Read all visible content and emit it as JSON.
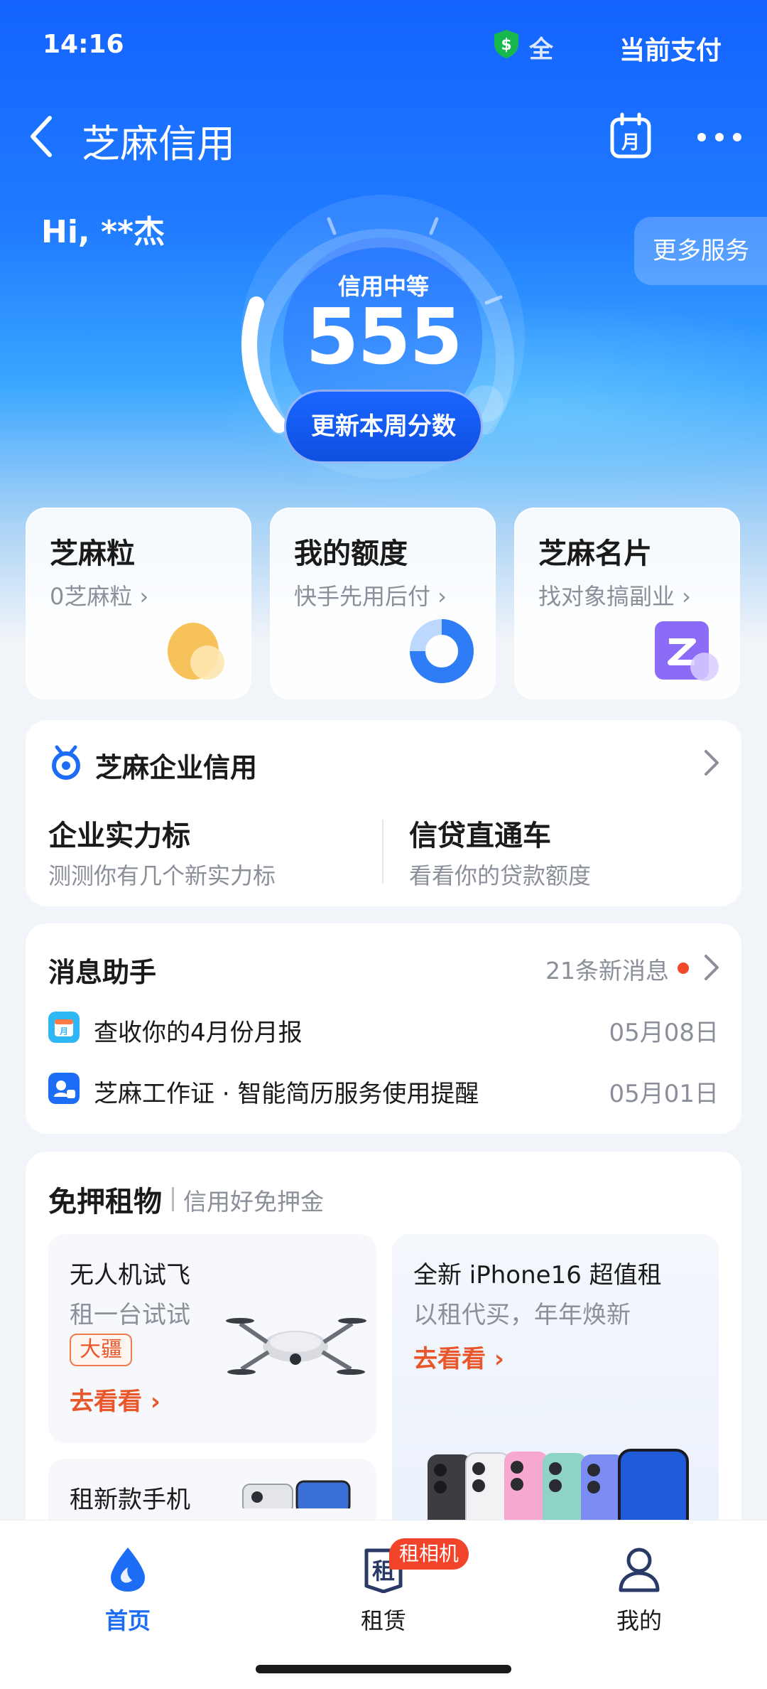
{
  "status_bar": {
    "time": "14:16",
    "network": "全",
    "pay_label": "当前支付"
  },
  "nav": {
    "title": "芝麻信用",
    "calendar_char": "月"
  },
  "greeting": "Hi, **杰",
  "more_services": "更多服务",
  "score": {
    "level": "信用中等",
    "value": "555",
    "refresh_label": "更新本周分数"
  },
  "top_cards": [
    {
      "title": "芝麻粒",
      "subtitle": "0芝麻粒 ›"
    },
    {
      "title": "我的额度",
      "subtitle": "快手先用后付 ›"
    },
    {
      "title": "芝麻名片",
      "subtitle": "找对象搞副业 ›"
    }
  ],
  "enterprise": {
    "title": "芝麻企业信用",
    "left": {
      "title": "企业实力标",
      "subtitle": "测测你有几个新实力标"
    },
    "right": {
      "title": "信贷直通车",
      "subtitle": "看看你的贷款额度"
    }
  },
  "messages": {
    "title": "消息助手",
    "count": "21条新消息",
    "items": [
      {
        "text": "查收你的4月份月报",
        "date": "05月08日",
        "icon": "calendar-icon"
      },
      {
        "text": "芝麻工作证 · 智能简历服务使用提醒",
        "date": "05月01日",
        "icon": "work-badge-icon"
      }
    ]
  },
  "rental": {
    "title": "免押租物",
    "subtitle": "信用好免押金",
    "items": [
      {
        "title": "无人机试飞",
        "subtitle": "租一台试试",
        "tag": "大疆",
        "link": "去看看 ›"
      },
      {
        "title": "全新 iPhone16 超值租",
        "subtitle": "以租代买，年年焕新",
        "link": "去看看 ›"
      },
      {
        "title": "租新款手机"
      }
    ]
  },
  "tabbar": {
    "tabs": [
      {
        "label": "首页",
        "active": true
      },
      {
        "label": "租赁",
        "active": false,
        "icon_char": "租"
      },
      {
        "label": "我的",
        "active": false
      }
    ],
    "badge": "租相机"
  },
  "colors": {
    "primary": "#1463ff",
    "accent": "#e8562a",
    "muted": "#8a8f99"
  }
}
